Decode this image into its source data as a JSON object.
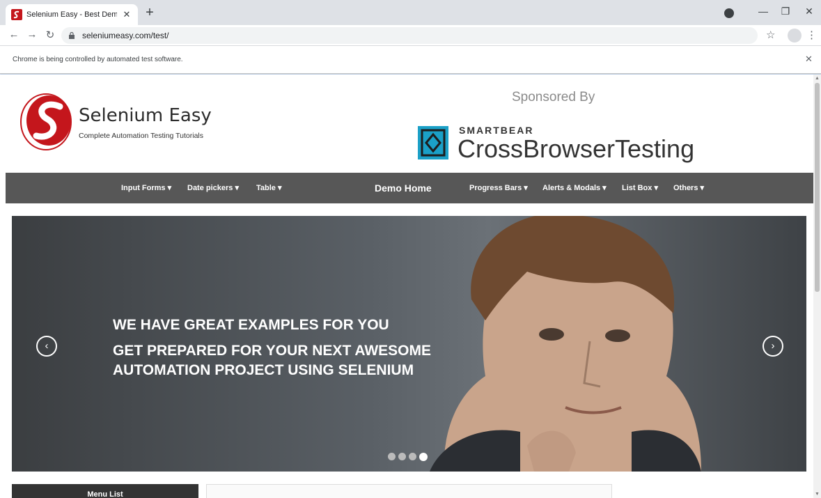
{
  "browser": {
    "tab_title": "Selenium Easy - Best Demo webs",
    "url": "seleniumeasy.com/test/",
    "infobar_text": "Chrome is being controlled by automated test software.",
    "icons": [
      "back-icon",
      "forward-icon",
      "reload-icon",
      "lock-icon",
      "star-icon",
      "profile-icon",
      "menu-icon",
      "minimize-icon",
      "restore-icon",
      "close-icon"
    ]
  },
  "header": {
    "brand_name": "Selenium Easy",
    "brand_tagline": "Complete Automation Testing Tutorials",
    "sponsored_by": "Sponsored By",
    "sponsor_company": "SMARTBEAR",
    "sponsor_product": "CrossBrowserTesting"
  },
  "nav": {
    "items": [
      {
        "label": "Input Forms ▾"
      },
      {
        "label": "Date pickers ▾"
      },
      {
        "label": "Table ▾"
      },
      {
        "label": "Demo Home"
      },
      {
        "label": "Progress Bars ▾"
      },
      {
        "label": "Alerts & Modals ▾"
      },
      {
        "label": "List Box ▾"
      },
      {
        "label": "Others ▾"
      }
    ]
  },
  "carousel": {
    "line1": "WE HAVE GREAT EXAMPLES FOR YOU",
    "line2": "GET PREPARED FOR YOUR NEXT AWESOME",
    "line3": "AUTOMATION PROJECT USING SELENIUM",
    "prev_label": "‹",
    "next_label": "›",
    "slide_count": 4,
    "active_slide": 4
  },
  "sidebar": {
    "menu_title": "Menu List"
  },
  "colors": {
    "brand_red": "#c4161c",
    "nav_bg": "#575757",
    "sponsor_teal": "#1ba0c7"
  }
}
